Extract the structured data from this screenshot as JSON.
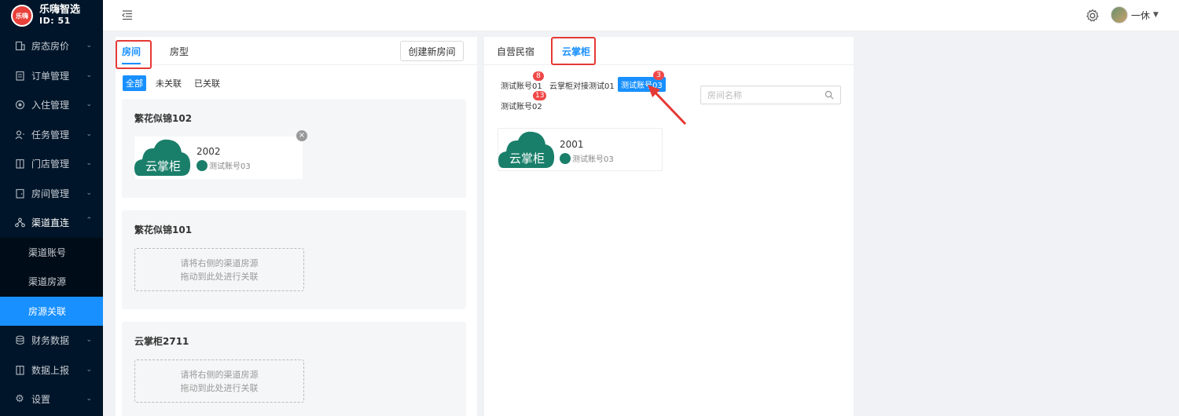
{
  "brand": {
    "name": "乐嗨智选",
    "id_text": "ID: 51",
    "logo_text": "乐嗨"
  },
  "sidebar": {
    "items": [
      {
        "label": "房态房价",
        "icon": "building-icon"
      },
      {
        "label": "订单管理",
        "icon": "order-icon"
      },
      {
        "label": "入住管理",
        "icon": "checkin-icon"
      },
      {
        "label": "任务管理",
        "icon": "task-icon"
      },
      {
        "label": "门店管理",
        "icon": "store-icon"
      },
      {
        "label": "房间管理",
        "icon": "room-icon"
      },
      {
        "label": "渠道直连",
        "icon": "channel-icon"
      }
    ],
    "subitems": [
      {
        "label": "渠道账号"
      },
      {
        "label": "渠道房源"
      },
      {
        "label": "房源关联"
      }
    ],
    "bottom_items": [
      {
        "label": "财务数据",
        "icon": "finance-icon"
      },
      {
        "label": "数据上报",
        "icon": "report-icon"
      },
      {
        "label": "设置",
        "icon": "gear-icon"
      }
    ]
  },
  "header": {
    "user_name": "一休"
  },
  "left": {
    "tabs": [
      "房间",
      "房型"
    ],
    "create_button": "创建新房间",
    "filters": [
      "全部",
      "未关联",
      "已关联"
    ],
    "rooms": [
      {
        "title": "繁花似锦102",
        "linked": {
          "room": "2002",
          "account": "测试账号03",
          "logo_text": "云掌柜"
        }
      },
      {
        "title": "繁花似锦101",
        "drop_line1": "请将右侧的渠道房源",
        "drop_line2": "拖动到此处进行关联"
      },
      {
        "title": "云掌柜2711",
        "drop_line1": "请将右侧的渠道房源",
        "drop_line2": "拖动到此处进行关联"
      }
    ]
  },
  "right": {
    "tabs": [
      "自营民宿",
      "云掌柜"
    ],
    "accounts": [
      {
        "label": "测试账号01",
        "badge": "8"
      },
      {
        "label": "云掌柜对接测试01",
        "badge": ""
      },
      {
        "label": "测试账号03",
        "badge": "3"
      },
      {
        "label": "测试账号02",
        "badge": "13"
      }
    ],
    "search_placeholder": "房间名称",
    "source": {
      "room": "2001",
      "account": "测试账号03",
      "logo_text": "云掌柜"
    }
  },
  "colors": {
    "primary": "#1890ff",
    "sidebar_bg": "#001529",
    "highlight_red": "#e53935",
    "cloud_green": "#1a7f6a"
  }
}
